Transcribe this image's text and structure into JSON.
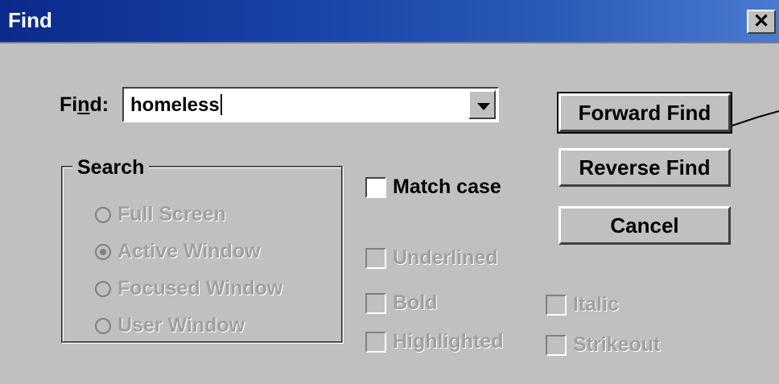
{
  "window": {
    "title": "Find",
    "close_glyph": "✕"
  },
  "find": {
    "label": "Find:",
    "value": "homeless"
  },
  "buttons": {
    "forward": "Forward Find",
    "reverse": "Reverse Find",
    "cancel": "Cancel"
  },
  "search": {
    "legend": "Search",
    "options": [
      {
        "label": "Full Screen",
        "checked": false
      },
      {
        "label": "Active Window",
        "checked": true
      },
      {
        "label": "Focused Window",
        "checked": false
      },
      {
        "label": "User Window",
        "checked": false
      }
    ]
  },
  "options": {
    "match_case": "Match case",
    "underlined": "Underlined",
    "bold": "Bold",
    "italic": "Italic",
    "highlighted": "Highlighted",
    "strikeout": "Strikeout"
  },
  "colors": {
    "titlebar": "#0a2a8c",
    "dialog": "#c0c0c0",
    "disabled_text": "#a0a0a0"
  }
}
